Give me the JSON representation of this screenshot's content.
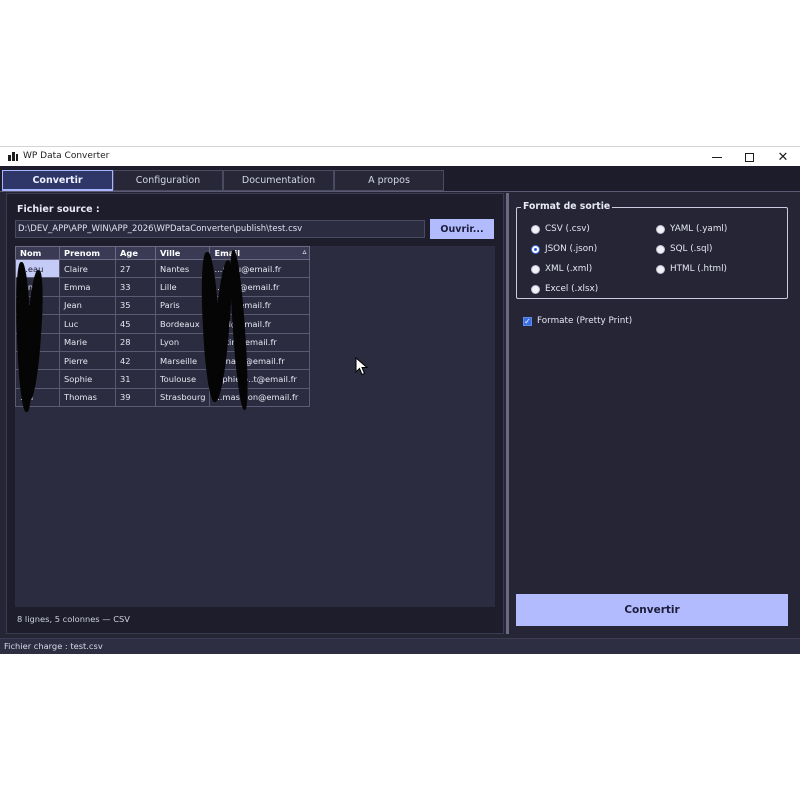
{
  "window": {
    "title": "WP Data Converter"
  },
  "tabs": [
    {
      "label": "Convertir",
      "active": true
    },
    {
      "label": "Configuration",
      "active": false
    },
    {
      "label": "Documentation",
      "active": false
    },
    {
      "label": "A propos",
      "active": false
    }
  ],
  "source": {
    "label": "Fichier source :",
    "path": "D:\\DEV_APP\\APP_WIN\\APP_2026\\WPDataConverter\\publish\\test.csv",
    "open_button": "Ouvrir..."
  },
  "grid": {
    "columns": [
      "Nom",
      "Prenom",
      "Age",
      "Ville",
      "Email"
    ],
    "sort_indicator": "▵",
    "rows": [
      [
        "...eau",
        "Claire",
        "27",
        "Nantes",
        "...reau@email.fr"
      ],
      [
        "...nt",
        "Emma",
        "33",
        "Lille",
        "...rent@email.fr"
      ],
      [
        "...nt",
        "Jean",
        "35",
        "Paris",
        "...nt@email.fr"
      ],
      [
        "...d",
        "Luc",
        "45",
        "Bordeaux",
        "...rd@email.fr"
      ],
      [
        "...n",
        "Marie",
        "28",
        "Lyon",
        "...rtin@email.fr"
      ],
      [
        "...rd",
        "Pierre",
        "42",
        "Marseille",
        "...rnard@email.fr"
      ],
      [
        "...t",
        "Sophie",
        "31",
        "Toulouse",
        "...phie.p..t@email.fr"
      ],
      [
        "...n",
        "Thomas",
        "39",
        "Strasbourg",
        "...mas...on@email.fr"
      ]
    ]
  },
  "grid_status": "8 lignes, 5 colonnes — CSV",
  "output_format": {
    "title": "Format de sortie",
    "options": [
      {
        "label": "CSV (.csv)",
        "selected": false
      },
      {
        "label": "YAML (.yaml)",
        "selected": false
      },
      {
        "label": "JSON (.json)",
        "selected": true
      },
      {
        "label": "SQL (.sql)",
        "selected": false
      },
      {
        "label": "XML (.xml)",
        "selected": false
      },
      {
        "label": "HTML (.html)",
        "selected": false
      },
      {
        "label": "Excel (.xlsx)",
        "selected": false
      }
    ]
  },
  "pretty_print": {
    "label": "Formate (Pretty Print)",
    "checked": true
  },
  "convert_button": "Convertir",
  "status_bar": "Fichier charge : test.csv",
  "colors": {
    "accent": "#b3bbff",
    "background": "#252536",
    "panel": "#1d1d2c",
    "grid_background": "#2c2c40",
    "selected_cell": "#c4cbf6"
  }
}
